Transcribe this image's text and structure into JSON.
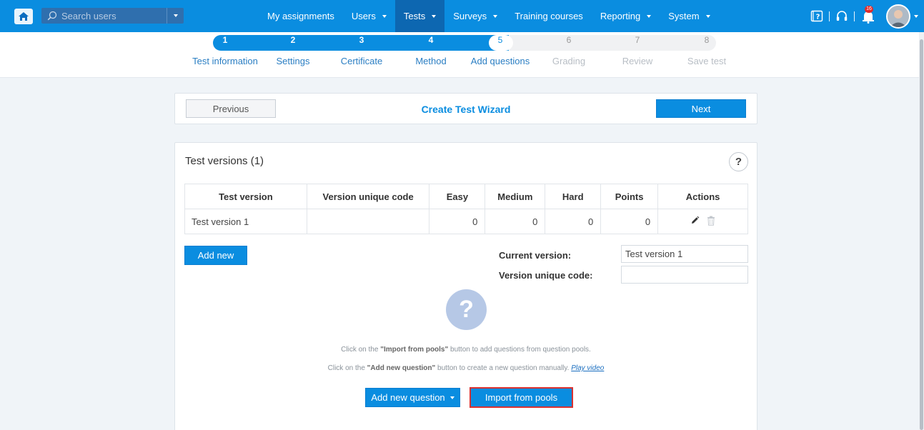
{
  "topnav": {
    "search_placeholder": "Search users",
    "menu": [
      {
        "label": "My assignments",
        "has_caret": false
      },
      {
        "label": "Users",
        "has_caret": true
      },
      {
        "label": "Tests",
        "has_caret": true,
        "active": true
      },
      {
        "label": "Surveys",
        "has_caret": true
      },
      {
        "label": "Training courses",
        "has_caret": false
      },
      {
        "label": "Reporting",
        "has_caret": true
      },
      {
        "label": "System",
        "has_caret": true
      }
    ],
    "notification_count": "16",
    "icons": [
      "home-icon",
      "search-icon",
      "help-book-icon",
      "headset-icon",
      "notification-bell-icon",
      "avatar"
    ]
  },
  "steps": [
    {
      "num": "1",
      "label": "Test information",
      "state": "done"
    },
    {
      "num": "2",
      "label": "Settings",
      "state": "done"
    },
    {
      "num": "3",
      "label": "Certificate",
      "state": "done"
    },
    {
      "num": "4",
      "label": "Method",
      "state": "done"
    },
    {
      "num": "5",
      "label": "Add questions",
      "state": "current"
    },
    {
      "num": "6",
      "label": "Grading",
      "state": "future"
    },
    {
      "num": "7",
      "label": "Review",
      "state": "future"
    },
    {
      "num": "8",
      "label": "Save test",
      "state": "future"
    }
  ],
  "wizard": {
    "previous_label": "Previous",
    "title": "Create Test Wizard",
    "next_label": "Next"
  },
  "versions": {
    "title": "Test versions (1)",
    "help_label": "?",
    "columns": [
      "Test version",
      "Version unique code",
      "Easy",
      "Medium",
      "Hard",
      "Points",
      "Actions"
    ],
    "rows": [
      {
        "name": "Test version 1",
        "code": "",
        "easy": "0",
        "medium": "0",
        "hard": "0",
        "points": "0"
      }
    ],
    "add_new_label": "Add new",
    "current_version_label": "Current version:",
    "current_version_value": "Test version 1",
    "version_code_label": "Version unique code:",
    "version_code_value": ""
  },
  "empty_state": {
    "icon_glyph": "?",
    "hint1_prefix": "Click on the ",
    "hint1_bold": "\"Import from pools\"",
    "hint1_suffix": " button to add questions from question pools.",
    "hint2_prefix": "Click on the ",
    "hint2_bold": "\"Add new question\"",
    "hint2_suffix": " button to create a new question manually.",
    "hint2_link": "Play video",
    "add_question_label": "Add new question",
    "import_label": "Import from pools"
  },
  "colors": {
    "primary": "#0a8de0",
    "nav_active": "#0d67b1",
    "highlight_border": "#d93232",
    "badge": "#e02b2b"
  }
}
